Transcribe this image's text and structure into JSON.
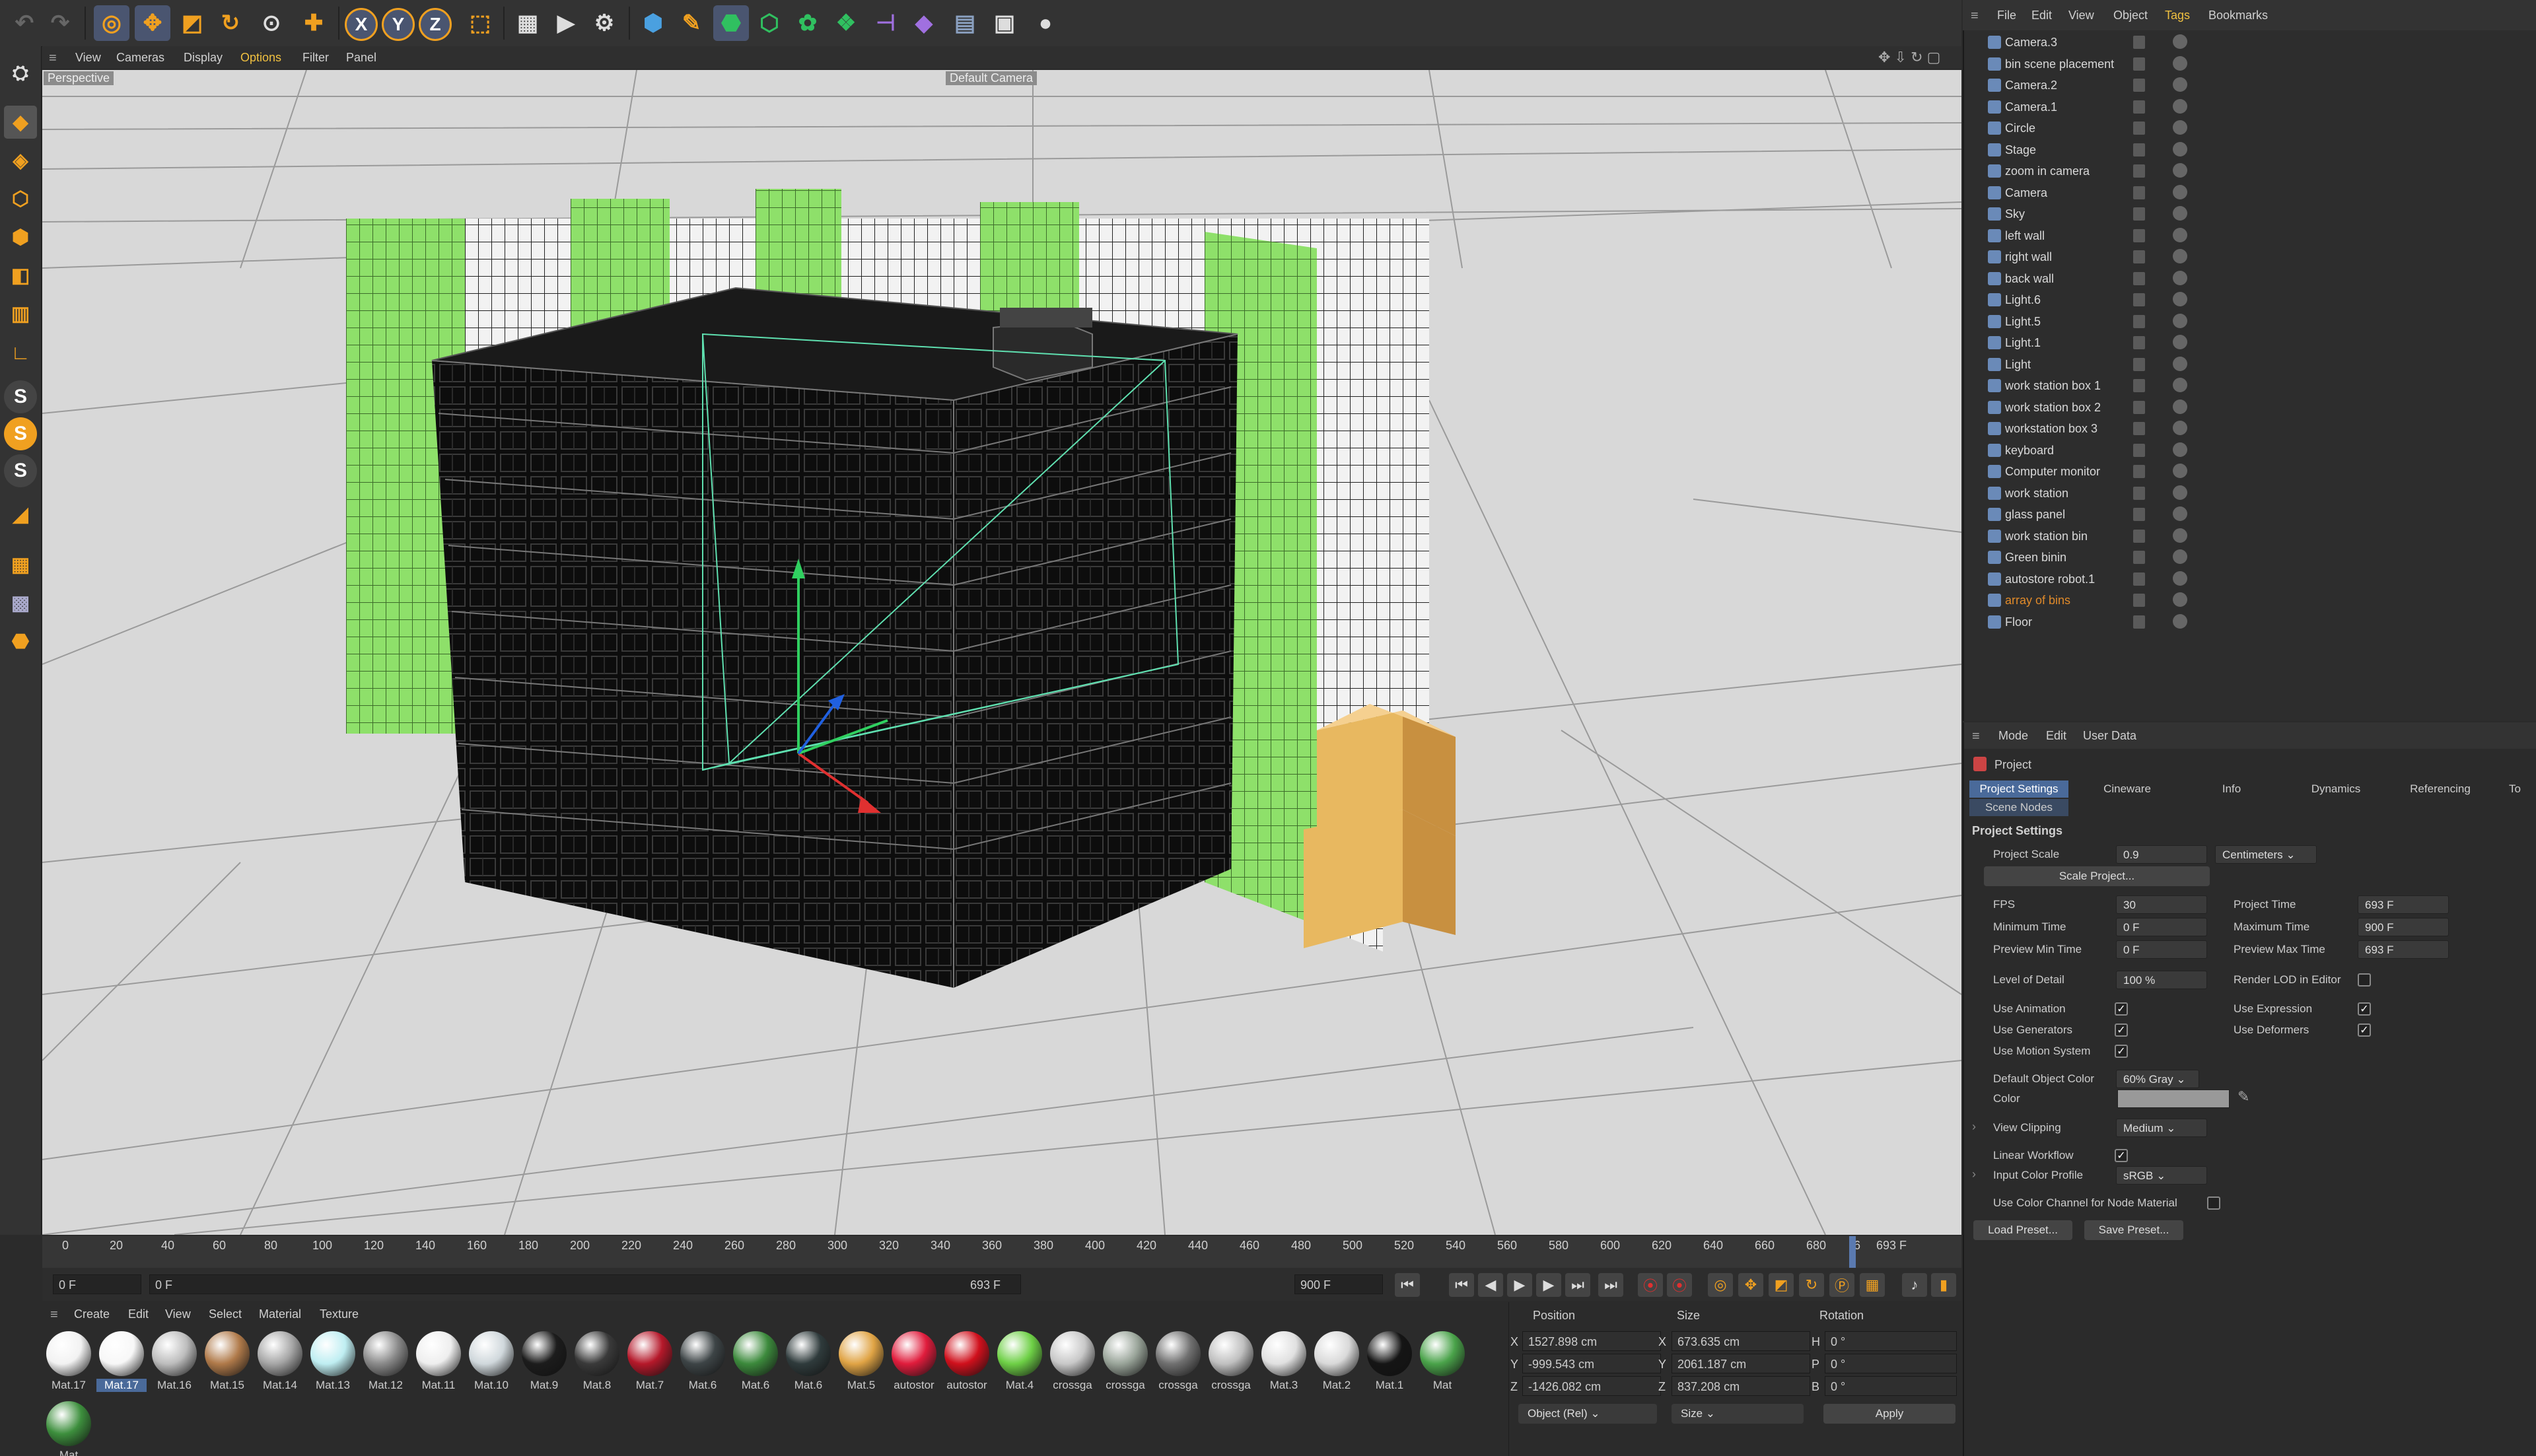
{
  "toolbar": {
    "items": [
      "undo-icon",
      "redo-icon",
      "live-selection-icon",
      "move-icon",
      "scale-icon",
      "rotate-icon",
      "render-region-icon",
      "add-icon",
      "x-axis-icon",
      "y-axis-icon",
      "z-axis-icon",
      "coordinate-system-icon",
      "render-view-icon",
      "render-icon",
      "render-settings-icon",
      "cube-icon",
      "pen-icon",
      "subdivision-icon",
      "extrude-icon",
      "cloner-icon",
      "mograph-icon",
      "deformer-icon",
      "scene-icon",
      "floor-icon",
      "camera-icon",
      "light-icon"
    ],
    "x_label": "X",
    "y_label": "Y",
    "z_label": "Z"
  },
  "viewport": {
    "menu": [
      "View",
      "Cameras",
      "Display",
      "Options",
      "Filter",
      "Panel"
    ],
    "projection": "Perspective",
    "camera": "Default Camera"
  },
  "timeline": {
    "ticks": [
      "0",
      "20",
      "40",
      "60",
      "80",
      "100",
      "120",
      "140",
      "160",
      "180",
      "200",
      "220",
      "240",
      "260",
      "280",
      "300",
      "320",
      "340",
      "360",
      "380",
      "400",
      "420",
      "440",
      "460",
      "480",
      "500",
      "520",
      "540",
      "560",
      "580",
      "600",
      "620",
      "640",
      "660",
      "680",
      "6"
    ],
    "current_frame": "693 F",
    "start_field": "0 F",
    "range_start": "0 F",
    "range_end": "693 F",
    "end_field": "900 F"
  },
  "materials": {
    "menu": [
      "Create",
      "Edit",
      "View",
      "Select",
      "Material",
      "Texture"
    ],
    "items": [
      {
        "label": "Mat.17",
        "color": "#f2f2f2"
      },
      {
        "label": "Mat.17",
        "color": "#f7f7f7",
        "selected": true
      },
      {
        "label": "Mat.16",
        "color": "#bdbdbd"
      },
      {
        "label": "Mat.15",
        "color": "#b07a4a"
      },
      {
        "label": "Mat.14",
        "color": "#a6a6a6"
      },
      {
        "label": "Mat.13",
        "color": "#bfeef2"
      },
      {
        "label": "Mat.12",
        "color": "#8a8a8a"
      },
      {
        "label": "Mat.11",
        "color": "#eeeeee"
      },
      {
        "label": "Mat.10",
        "color": "#d0d8dc"
      },
      {
        "label": "Mat.9",
        "color": "#1c1c1c"
      },
      {
        "label": "Mat.8",
        "color": "#3a3a3a"
      },
      {
        "label": "Mat.7",
        "color": "#b5182a"
      },
      {
        "label": "Mat.6",
        "color": "#3d4446"
      },
      {
        "label": "Mat.6",
        "color": "#3c8a3c"
      },
      {
        "label": "Mat.6",
        "color": "#2f3b3c"
      },
      {
        "label": "Mat.5",
        "color": "#e0a445"
      },
      {
        "label": "autostor",
        "color": "#e01c3c"
      },
      {
        "label": "autostor",
        "color": "#d0101c"
      },
      {
        "label": "Mat.4",
        "color": "#6ed046"
      },
      {
        "label": "crossga",
        "color": "#c8c8c8"
      },
      {
        "label": "crossga",
        "color": "#9aa59a"
      },
      {
        "label": "crossga",
        "color": "#707070"
      },
      {
        "label": "crossga",
        "color": "#c0c0c0"
      },
      {
        "label": "Mat.3",
        "color": "#e0e0e0"
      },
      {
        "label": "Mat.2",
        "color": "#d9d9d9"
      },
      {
        "label": "Mat.1",
        "color": "#151515"
      },
      {
        "label": "Mat",
        "color": "#4aa34a"
      },
      {
        "label": "Mat",
        "color": "#3d8f3d"
      }
    ]
  },
  "coordinates": {
    "headers": [
      "Position",
      "Size",
      "Rotation"
    ],
    "rows": [
      {
        "axis": "X",
        "pos": "1527.898 cm",
        "size_axis": "X",
        "size": "673.635 cm",
        "rot_axis": "H",
        "rot": "0 °"
      },
      {
        "axis": "Y",
        "pos": "-999.543 cm",
        "size_axis": "Y",
        "size": "2061.187 cm",
        "rot_axis": "P",
        "rot": "0 °"
      },
      {
        "axis": "Z",
        "pos": "-1426.082 cm",
        "size_axis": "Z",
        "size": "837.208 cm",
        "rot_axis": "B",
        "rot": "0 °"
      }
    ],
    "mode": "Object (Rel)",
    "size_mode": "Size",
    "apply": "Apply"
  },
  "object_manager": {
    "menu": [
      "File",
      "Edit",
      "View",
      "Object",
      "Tags",
      "Bookmarks"
    ],
    "active_menu": "Tags",
    "objects": [
      {
        "name": "Camera.3",
        "color": "#d8d8d8"
      },
      {
        "name": "bin scene placement",
        "color": "#d8d8d8"
      },
      {
        "name": "Camera.2",
        "color": "#d8d8d8"
      },
      {
        "name": "Camera.1",
        "color": "#d8d8d8"
      },
      {
        "name": "Circle",
        "color": "#d8d8d8"
      },
      {
        "name": "Stage",
        "color": "#d8d8d8"
      },
      {
        "name": "zoom in camera",
        "color": "#d8d8d8"
      },
      {
        "name": "Camera",
        "color": "#d8d8d8"
      },
      {
        "name": "Sky",
        "color": "#d8d8d8"
      },
      {
        "name": "left wall",
        "color": "#d8d8d8"
      },
      {
        "name": "right wall",
        "color": "#d8d8d8"
      },
      {
        "name": "back wall",
        "color": "#d8d8d8"
      },
      {
        "name": "Light.6",
        "color": "#d8d8d8"
      },
      {
        "name": "Light.5",
        "color": "#d8d8d8"
      },
      {
        "name": "Light.1",
        "color": "#d8d8d8"
      },
      {
        "name": "Light",
        "color": "#d8d8d8"
      },
      {
        "name": "work station box 1",
        "color": "#d8d8d8"
      },
      {
        "name": "work station box 2",
        "color": "#d8d8d8"
      },
      {
        "name": "workstation box 3",
        "color": "#d8d8d8"
      },
      {
        "name": "keyboard",
        "color": "#d8d8d8"
      },
      {
        "name": "Computer monitor",
        "color": "#d8d8d8"
      },
      {
        "name": "work station",
        "color": "#d8d8d8"
      },
      {
        "name": "glass panel",
        "color": "#d8d8d8"
      },
      {
        "name": "work station bin",
        "color": "#d8d8d8"
      },
      {
        "name": "Green binin",
        "color": "#d8d8d8"
      },
      {
        "name": "autostore robot.1",
        "color": "#d8d8d8"
      },
      {
        "name": "array of bins",
        "color": "#e08a2a"
      },
      {
        "name": "Floor",
        "color": "#d8d8d8"
      }
    ]
  },
  "attributes": {
    "menu": [
      "Mode",
      "Edit",
      "User Data"
    ],
    "object": "Project",
    "tabs": [
      "Project Settings",
      "Cineware",
      "Info",
      "Dynamics",
      "Referencing",
      "To"
    ],
    "subtab": "Scene Nodes",
    "section": "Project Settings",
    "project_scale_label": "Project Scale",
    "project_scale": "0.9",
    "scale_unit": "Centimeters",
    "scale_project_button": "Scale Project...",
    "fps_label": "FPS",
    "fps": "30",
    "project_time_label": "Project Time",
    "project_time": "693 F",
    "min_time_label": "Minimum Time",
    "min_time": "0 F",
    "max_time_label": "Maximum Time",
    "max_time": "900 F",
    "preview_min_label": "Preview Min Time",
    "preview_min": "0 F",
    "preview_max_label": "Preview Max Time",
    "preview_max": "693 F",
    "lod_label": "Level of Detail",
    "lod": "100 %",
    "render_lod_label": "Render LOD in Editor",
    "use_animation": "Use Animation",
    "use_expression": "Use Expression",
    "use_generators": "Use Generators",
    "use_deformers": "Use Deformers",
    "use_motion": "Use Motion System",
    "default_obj_color_label": "Default Object Color",
    "default_obj_color": "60% Gray",
    "color_label": "Color",
    "view_clipping_label": "View Clipping",
    "view_clipping": "Medium",
    "linear_workflow": "Linear Workflow",
    "input_color_label": "Input Color Profile",
    "input_color": "sRGB",
    "use_color_channel": "Use Color Channel for Node Material",
    "load_preset": "Load Preset...",
    "save_preset": "Save Preset..."
  }
}
